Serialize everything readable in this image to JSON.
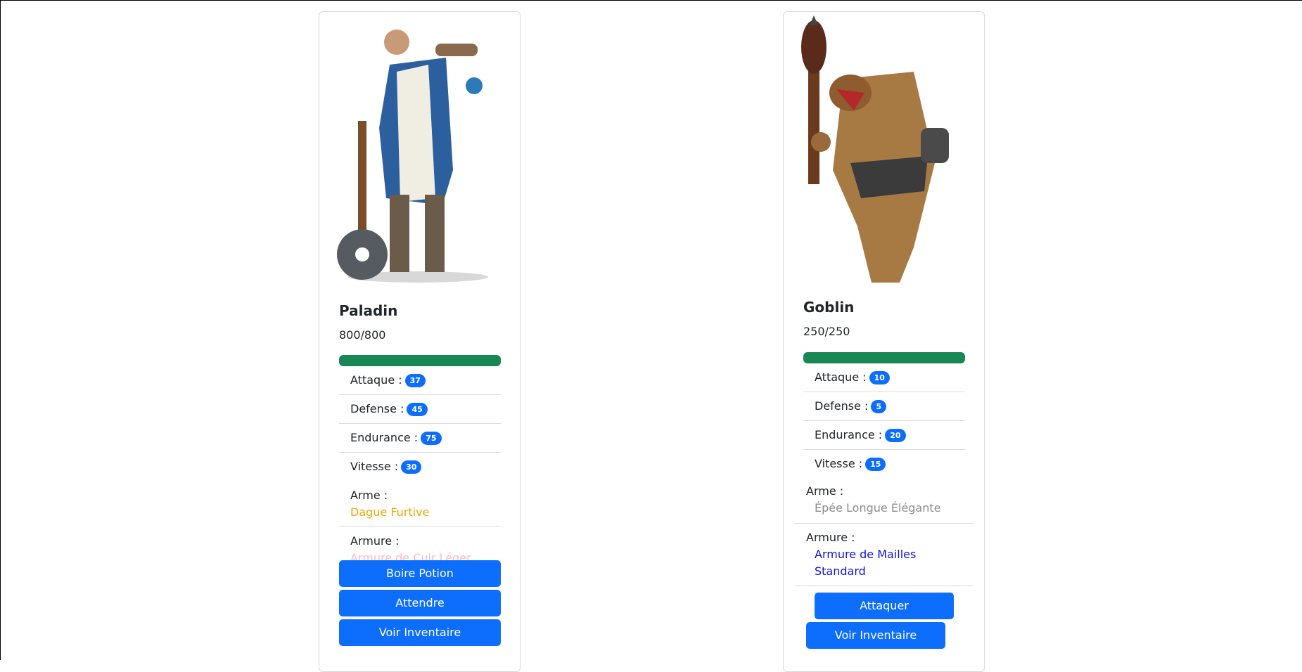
{
  "colors": {
    "accent": "#0d6efd",
    "hp": "#198754",
    "weapon_left": "#f0a500",
    "armor_left": "#ffb6c1",
    "weapon_right": "#8c8c8c",
    "armor_right": "#1111dd"
  },
  "left": {
    "name": "Paladin",
    "hp": "800/800",
    "hp_fraction": 1.0,
    "stats": [
      {
        "label": "Attaque :",
        "value": "37"
      },
      {
        "label": "Defense :",
        "value": "45"
      },
      {
        "label": "Endurance :",
        "value": "75"
      },
      {
        "label": "Vitesse :",
        "value": "30"
      }
    ],
    "weapon": {
      "label": "Arme :",
      "value": "Dague Furtive"
    },
    "armor": {
      "label": "Armure :",
      "value": "Armure de Cuir Léger"
    },
    "buttons": [
      "Boire Potion",
      "Attendre",
      "Voir Inventaire"
    ]
  },
  "right": {
    "name": "Goblin",
    "hp": "250/250",
    "hp_fraction": 1.0,
    "stats": [
      {
        "label": "Attaque :",
        "value": "10"
      },
      {
        "label": "Defense :",
        "value": "5"
      },
      {
        "label": "Endurance :",
        "value": "20"
      },
      {
        "label": "Vitesse :",
        "value": "15"
      }
    ],
    "weapon": {
      "label": "Arme :",
      "value": "Épée Longue Élégante"
    },
    "armor": {
      "label": "Armure :",
      "value": "Armure de Mailles Standard"
    },
    "buttons": [
      "Attaquer",
      "Voir Inventaire"
    ]
  }
}
